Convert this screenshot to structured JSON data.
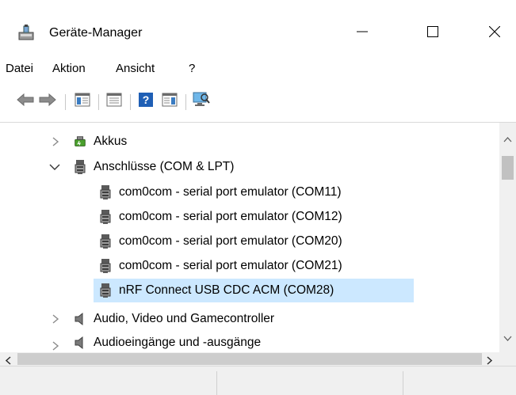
{
  "window": {
    "title": "Geräte-Manager",
    "icons": {
      "app": "device-manager-icon",
      "minimize": "minimize-icon",
      "maximize": "maximize-icon",
      "close": "close-icon"
    }
  },
  "menu": {
    "items": [
      {
        "label": "Datei"
      },
      {
        "label": "Aktion"
      },
      {
        "label": "Ansicht"
      },
      {
        "label": "?"
      }
    ]
  },
  "toolbar": {
    "buttons": [
      {
        "icon": "back-arrow-icon"
      },
      {
        "icon": "forward-arrow-icon"
      },
      {
        "icon": "show-hide-console-tree-icon"
      },
      {
        "icon": "properties-icon"
      },
      {
        "icon": "help-icon"
      },
      {
        "icon": "action-pane-icon"
      },
      {
        "icon": "scan-hardware-icon"
      }
    ]
  },
  "tree": {
    "nodes": [
      {
        "label": "Akkus",
        "expanded": false,
        "icon": "battery-icon"
      },
      {
        "label": "Anschlüsse (COM & LPT)",
        "expanded": true,
        "icon": "port-icon"
      },
      {
        "label": "com0com - serial port emulator (COM11)",
        "icon": "port-icon"
      },
      {
        "label": "com0com - serial port emulator (COM12)",
        "icon": "port-icon"
      },
      {
        "label": "com0com - serial port emulator (COM20)",
        "icon": "port-icon"
      },
      {
        "label": "com0com - serial port emulator (COM21)",
        "icon": "port-icon"
      },
      {
        "label": "nRF Connect USB CDC ACM (COM28)",
        "icon": "port-icon",
        "selected": true
      },
      {
        "label": "Audio, Video und Gamecontroller",
        "expanded": false,
        "icon": "speaker-icon"
      },
      {
        "label": "Audioeingänge und -ausgänge",
        "expanded": false,
        "icon": "speaker-icon"
      }
    ]
  },
  "colors": {
    "selection": "#cce8ff",
    "scrollbar_track": "#f0f0f0",
    "scrollbar_thumb": "#c1c1c1"
  }
}
